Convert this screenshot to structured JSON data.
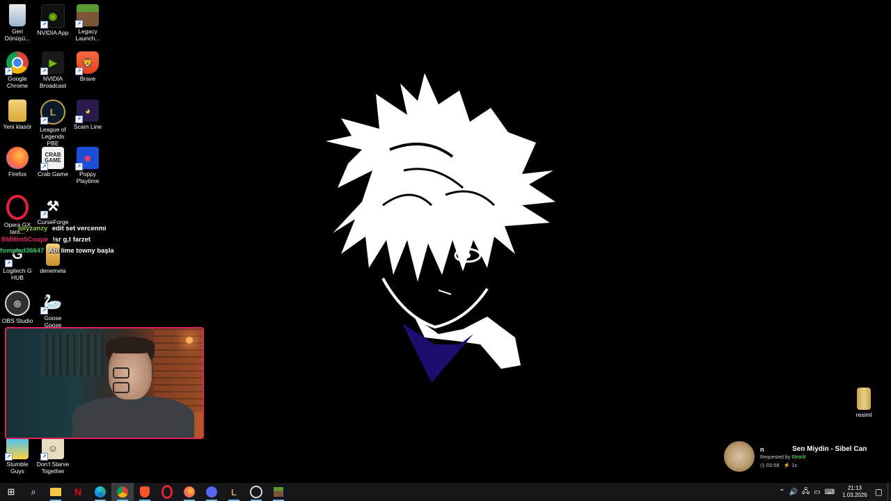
{
  "desktop_icons": [
    {
      "label": "Geri\nDönüşü...",
      "icon": "recycle-bin-icon"
    },
    {
      "label": "NVIDIA App",
      "icon": "nvidia-app-icon"
    },
    {
      "label": "Legacy\nLaunch...",
      "icon": "minecraft-legacy-icon"
    },
    {
      "label": "Google\nChrome",
      "icon": "chrome-icon"
    },
    {
      "label": "NVIDIA\nBroadcast",
      "icon": "nvidia-broadcast-icon"
    },
    {
      "label": "Brave",
      "icon": "brave-icon"
    },
    {
      "label": "Yeni klasör",
      "icon": "folder-icon"
    },
    {
      "label": "League of\nLegends PBE",
      "icon": "league-icon"
    },
    {
      "label": "Scam Line",
      "icon": "scam-line-icon"
    },
    {
      "label": "Firefox",
      "icon": "firefox-icon"
    },
    {
      "label": "Crab Game",
      "icon": "crab-game-icon"
    },
    {
      "label": "Poppy\nPlaytime",
      "icon": "poppy-playtime-icon"
    },
    {
      "label": "Opera GX\ntara...",
      "icon": "opera-gx-icon"
    },
    {
      "label": "CurseForge",
      "icon": "curseforge-icon"
    },
    {
      "label": "Logitech G\nHUB",
      "icon": "logitech-icon"
    },
    {
      "label": "denemela",
      "icon": "file-icon"
    },
    {
      "label": "OBS Studio",
      "icon": "obs-icon"
    },
    {
      "label": "Goose Goose\nDuck",
      "icon": "goose-icon"
    },
    {
      "label": "Stumble\nGuys",
      "icon": "stumble-guys-icon"
    },
    {
      "label": "Don't Starve\nTogether",
      "icon": "dont-starve-icon"
    },
    {
      "label": "resiml",
      "icon": "archive-icon"
    }
  ],
  "chat": [
    {
      "user": "jolyzanzy",
      "message": "edit set vercenmi",
      "color": "#9acd32"
    },
    {
      "user": "BMWm5Coupe",
      "message": "!sr g,t farzet",
      "color": "#e0245e"
    },
    {
      "user": "fomplad36647",
      "message": "Abi lime towny başla",
      "color": "#2ecc71"
    }
  ],
  "music": {
    "prefix": "n",
    "title": "Sen Miydin - Sibel Can",
    "requested_label": "Requested by",
    "requester": "StroiX",
    "time": "03:58",
    "speed": "1x"
  },
  "taskbar": {
    "apps": [
      "start-icon",
      "search-icon",
      "file-explorer-icon",
      "netflix-icon",
      "edge-icon",
      "chrome-icon",
      "brave-icon",
      "opera-gx-icon",
      "firefox-icon",
      "discord-icon",
      "league-icon",
      "obs-icon",
      "minecraft-icon"
    ],
    "time": "21:13",
    "date": "1.03.2026"
  },
  "colors": {
    "webcam_border": "#e0245e",
    "collar": "#1a0f6e"
  }
}
